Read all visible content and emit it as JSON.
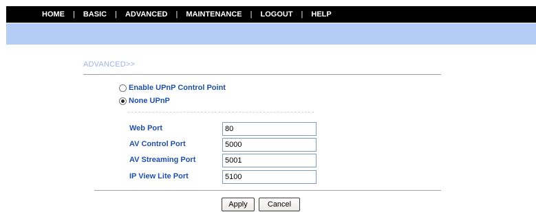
{
  "nav": {
    "items": [
      "HOME",
      "BASIC",
      "ADVANCED",
      "MAINTENANCE",
      "LOGOUT",
      "HELP"
    ],
    "separator": "|"
  },
  "section": {
    "title": "ADVANCED>>"
  },
  "upnp": {
    "options": [
      {
        "label": "Enable UPnP Control Point",
        "selected": false
      },
      {
        "label": "None UPnP",
        "selected": true
      }
    ]
  },
  "ports": [
    {
      "label": "Web Port",
      "value": "80"
    },
    {
      "label": "AV Control Port",
      "value": "5000"
    },
    {
      "label": "AV Streaming Port",
      "value": "5001"
    },
    {
      "label": "IP View Lite Port",
      "value": "5100"
    }
  ],
  "buttons": {
    "apply": "Apply",
    "cancel": "Cancel"
  },
  "colors": {
    "topbar": "#000000",
    "bluebar": "#b3cdf6",
    "label": "#1f4fa8",
    "section_title": "#9ab6e8"
  }
}
